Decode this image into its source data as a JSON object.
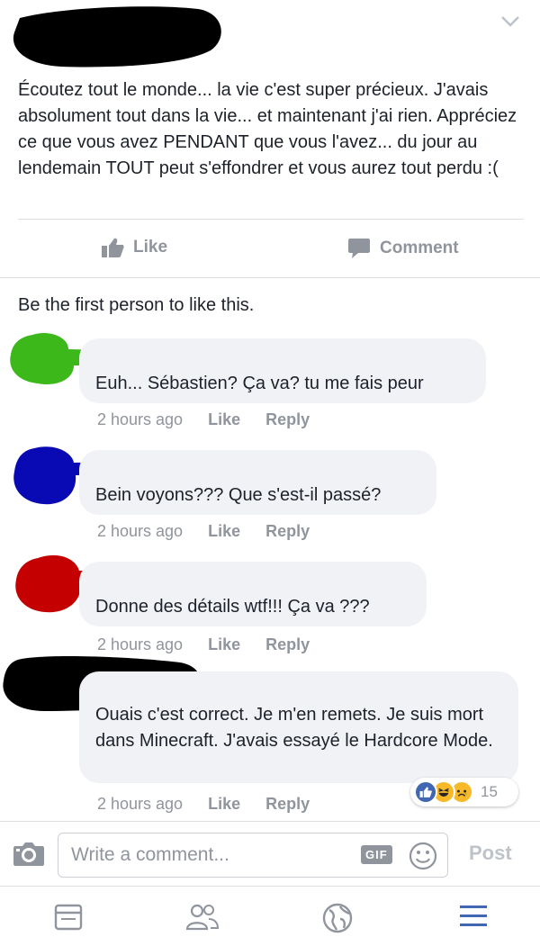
{
  "post": {
    "text": "Écoutez tout le monde... la vie c'est super précieux. J'avais absolument tout dans la vie... et maintenant j'ai rien. Appréciez ce que vous avez PENDANT que vous l'avez... du jour au lendemain TOUT peut s'effondrer et vous aurez tout perdu :(",
    "like_label": "Like",
    "comment_label": "Comment"
  },
  "likes_summary": "Be the first person to like this.",
  "comments": [
    {
      "text": "Euh... Sébastien? Ça va? tu me fais peur",
      "time": "2 hours ago",
      "like": "Like",
      "reply": "Reply",
      "redaction_color": "#3db81a"
    },
    {
      "text": "Bein voyons??? Que s'est-il passé?",
      "time": "2 hours ago",
      "like": "Like",
      "reply": "Reply",
      "redaction_color": "#0a0ab4"
    },
    {
      "text": "Donne des détails wtf!!! Ça va ???",
      "time": "2 hours ago",
      "like": "Like",
      "reply": "Reply",
      "redaction_color": "#c40000"
    },
    {
      "text": "Ouais c'est correct. Je m'en remets. Je suis mort dans Minecraft. J'avais essayé le Hardcore Mode.",
      "time": "2 hours ago",
      "like": "Like",
      "reply": "Reply",
      "redaction_color": "#000000",
      "reaction_count": "15"
    }
  ],
  "composer": {
    "placeholder": "Write a comment...",
    "gif_label": "GIF",
    "post_label": "Post"
  },
  "colors": {
    "accent": "#4267b2",
    "muted": "#90949c",
    "bubble": "#f1f2f6"
  },
  "icons": [
    "chevron-down-icon",
    "like-icon",
    "comment-icon",
    "camera-icon",
    "smiley-icon",
    "news-feed-icon",
    "friends-icon",
    "globe-icon",
    "menu-icon"
  ]
}
